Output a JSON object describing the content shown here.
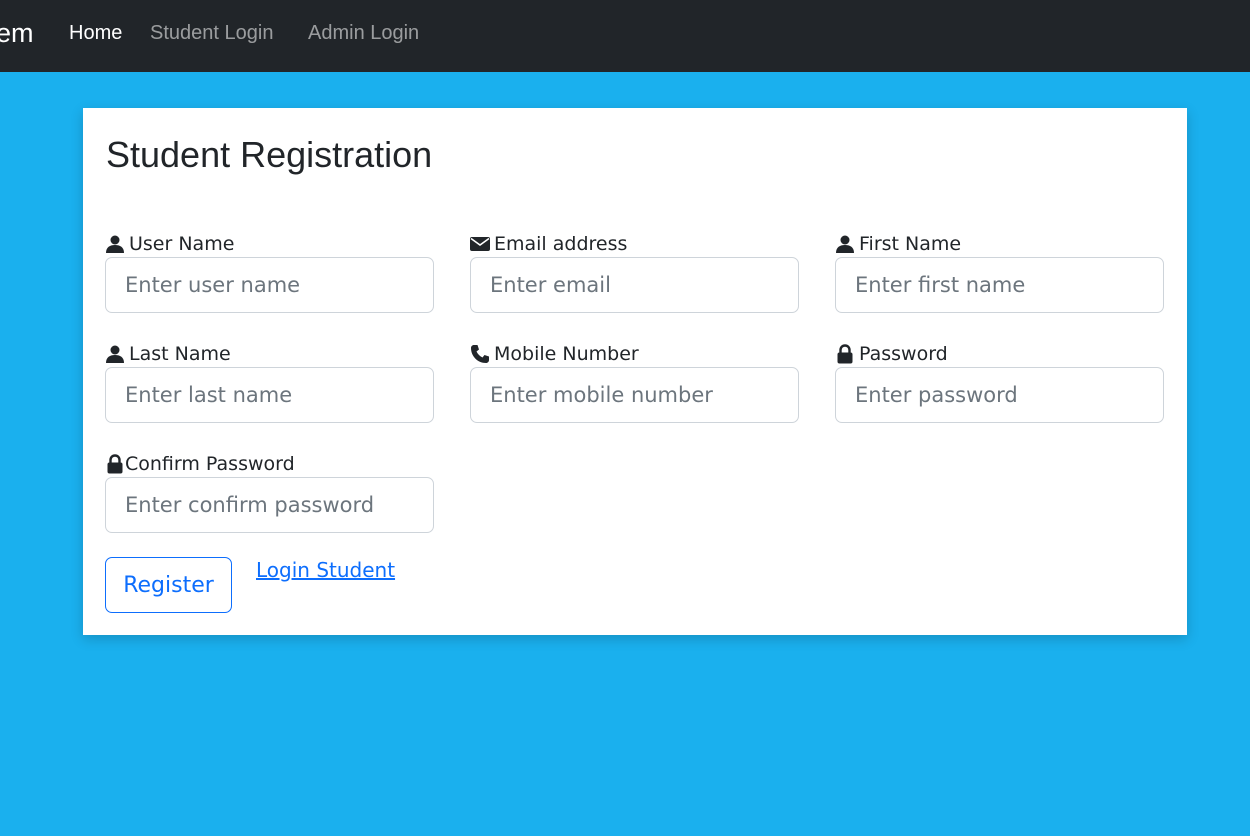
{
  "navbar": {
    "brand": "em",
    "links": [
      {
        "label": "Home",
        "active": true
      },
      {
        "label": "Student Login",
        "active": false
      },
      {
        "label": "Admin Login",
        "active": false
      }
    ]
  },
  "form": {
    "title": "Student Registration",
    "fields": [
      {
        "label": "User Name",
        "icon": "user-icon",
        "placeholder": "Enter user name",
        "value": ""
      },
      {
        "label": "Email address",
        "icon": "envelope-icon",
        "placeholder": "Enter email",
        "value": ""
      },
      {
        "label": "First Name",
        "icon": "user-icon",
        "placeholder": "Enter first name",
        "value": ""
      },
      {
        "label": "Last Name",
        "icon": "user-icon",
        "placeholder": "Enter last name",
        "value": ""
      },
      {
        "label": "Mobile Number",
        "icon": "phone-icon",
        "placeholder": "Enter mobile number",
        "value": ""
      },
      {
        "label": "Password",
        "icon": "lock-icon",
        "placeholder": "Enter password",
        "value": ""
      },
      {
        "label": "Confirm Password",
        "icon": "lock-icon",
        "placeholder": "Enter confirm password",
        "value": ""
      }
    ],
    "register_label": "Register",
    "login_link_label": "Login Student"
  },
  "colors": {
    "page_background": "#1ab0ee",
    "navbar_background": "#212529",
    "accent": "#0d6efd"
  }
}
